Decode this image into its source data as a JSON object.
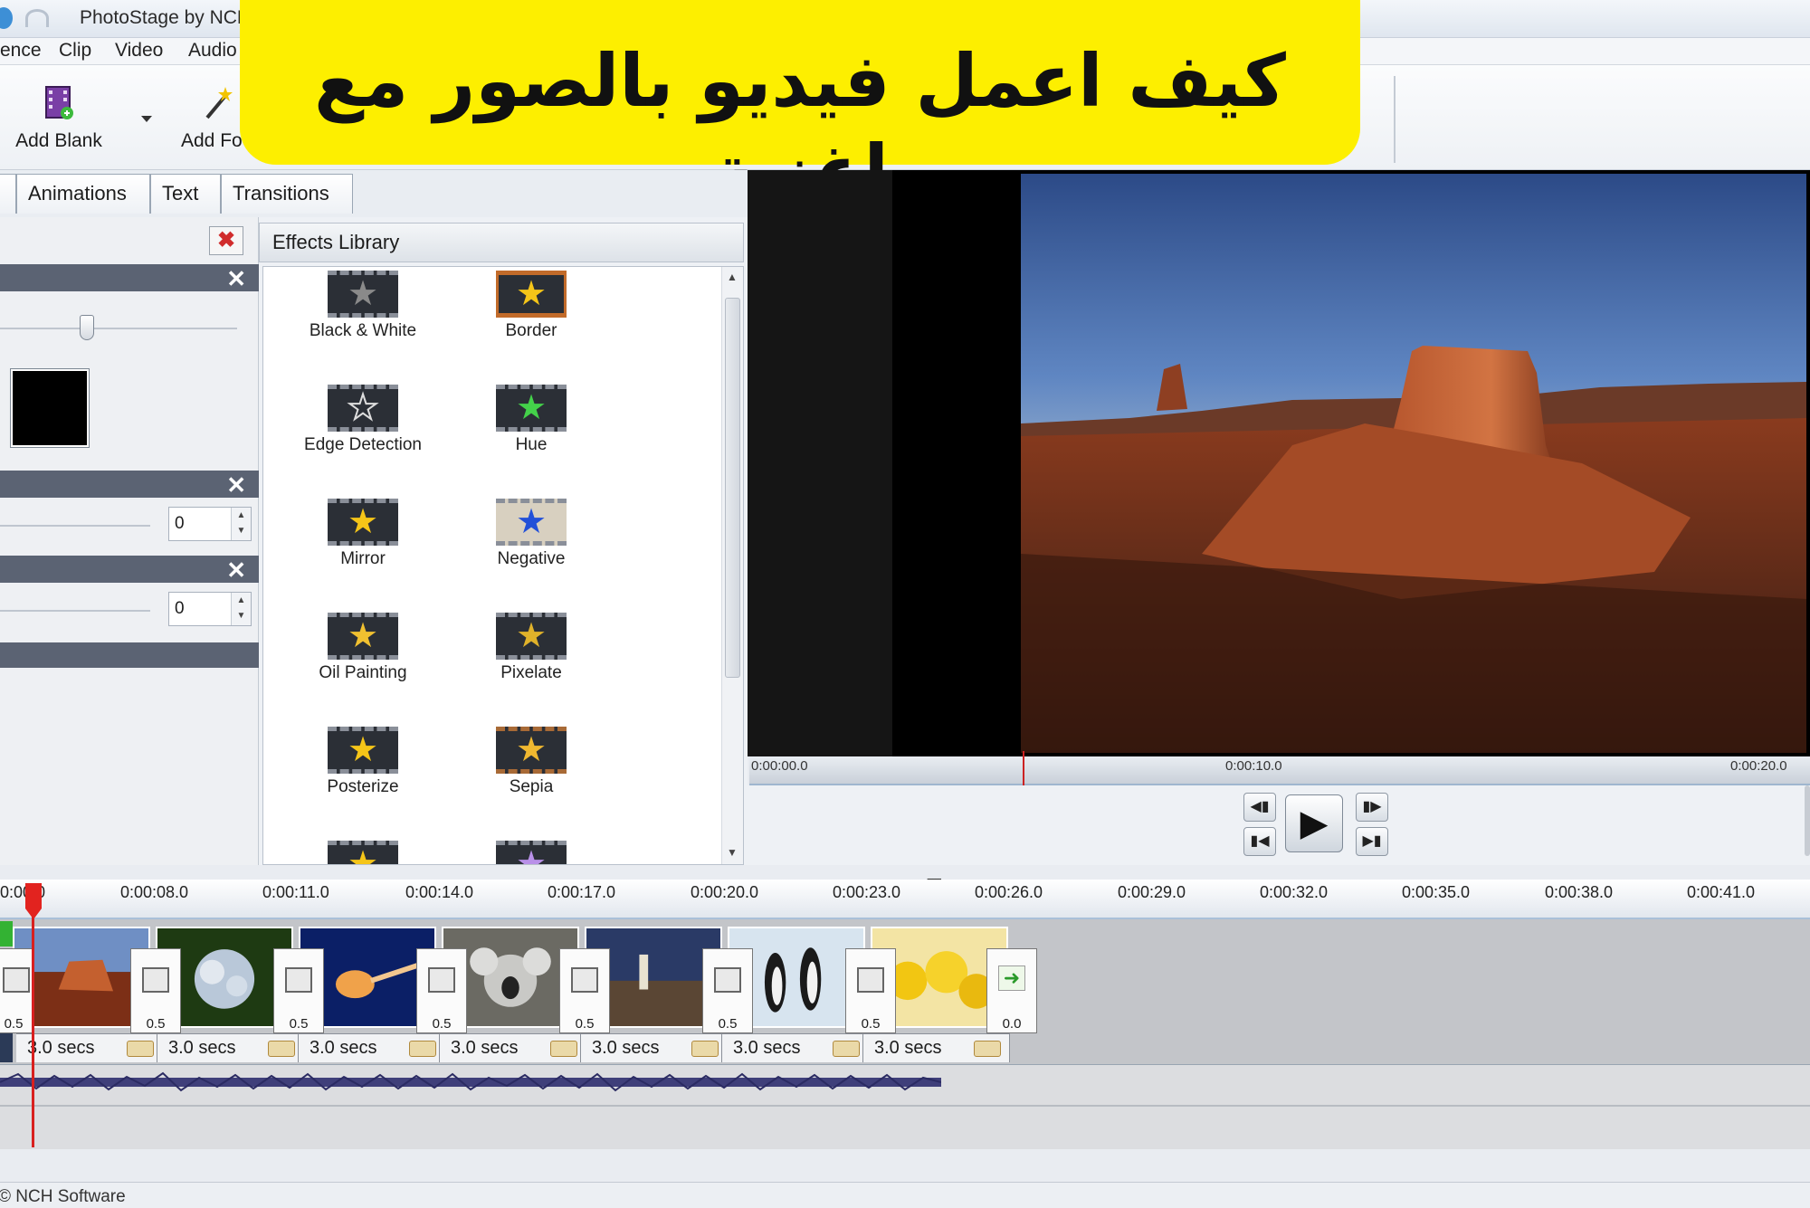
{
  "window": {
    "title": "PhotoStage by NCH"
  },
  "menu": [
    "ence",
    "Clip",
    "Video",
    "Audio"
  ],
  "toolbar": {
    "add_blank": "Add Blank",
    "add_folder": "Add Fo"
  },
  "banner": {
    "text": "كيف اعمل فيديو بالصور مع اغنية",
    "bg_color": "#fdef00"
  },
  "tabs": [
    {
      "label": "Animations"
    },
    {
      "label": "Text"
    },
    {
      "label": "Transitions"
    }
  ],
  "properties": {
    "spin1": "0",
    "spin2": "0",
    "swatch_color": "#000000"
  },
  "effects_library": {
    "title": "Effects Library",
    "items": [
      {
        "label": "Black & White",
        "icon": "star-gray-icon"
      },
      {
        "label": "Border",
        "icon": "star-border-icon"
      },
      {
        "label": "Edge Detection",
        "icon": "star-outline-icon"
      },
      {
        "label": "Hue",
        "icon": "star-green-icon"
      },
      {
        "label": "Mirror",
        "icon": "star-mirror-icon"
      },
      {
        "label": "Negative",
        "icon": "star-blue-icon"
      },
      {
        "label": "Oil Painting",
        "icon": "star-oil-icon"
      },
      {
        "label": "Pixelate",
        "icon": "star-pixel-icon"
      },
      {
        "label": "Posterize",
        "icon": "star-poster-icon"
      },
      {
        "label": "Sepia",
        "icon": "star-sepia-icon"
      }
    ]
  },
  "preview": {
    "ruler": [
      "0:00:00.0",
      "0:00:10.0",
      "0:00:20.0"
    ]
  },
  "timeline": {
    "ticks": [
      "0:00:0",
      "0:00:08.0",
      "0:00:11.0",
      "0:00:14.0",
      "0:00:17.0",
      "0:00:20.0",
      "0:00:23.0",
      "0:00:26.0",
      "0:00:29.0",
      "0:00:32.0",
      "0:00:35.0",
      "0:00:38.0",
      "0:00:41.0"
    ],
    "slides": [
      {
        "name": "desert"
      },
      {
        "name": "hydrangea"
      },
      {
        "name": "jellyfish"
      },
      {
        "name": "koala"
      },
      {
        "name": "lighthouse"
      },
      {
        "name": "penguins"
      },
      {
        "name": "tulips"
      }
    ],
    "transitions": [
      "0.5",
      "0.5",
      "0.5",
      "0.5",
      "0.5",
      "0.5",
      "0.5",
      "0.0"
    ],
    "durations": [
      "3.0 secs",
      "3.0 secs",
      "3.0 secs",
      "3.0 secs",
      "3.0 secs",
      "3.0 secs",
      "3.0 secs"
    ]
  },
  "status": {
    "text": "© NCH Software"
  }
}
